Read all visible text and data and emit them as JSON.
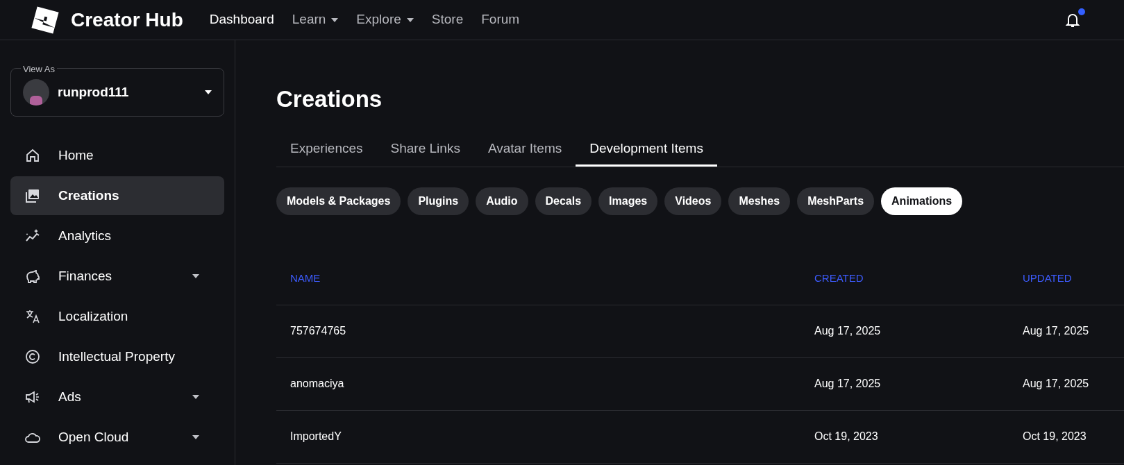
{
  "header": {
    "brand": "Creator Hub",
    "nav": [
      {
        "label": "Dashboard",
        "selected": true,
        "has_menu": false
      },
      {
        "label": "Learn",
        "selected": false,
        "has_menu": true
      },
      {
        "label": "Explore",
        "selected": false,
        "has_menu": true
      },
      {
        "label": "Store",
        "selected": false,
        "has_menu": false
      },
      {
        "label": "Forum",
        "selected": false,
        "has_menu": false
      }
    ],
    "notification_unread": true
  },
  "sidebar": {
    "view_as": {
      "label": "View As",
      "user": "runprod111"
    },
    "items": [
      {
        "label": "Home",
        "selected": false,
        "has_menu": false
      },
      {
        "label": "Creations",
        "selected": true,
        "has_menu": false
      },
      {
        "label": "Analytics",
        "selected": false,
        "has_menu": false
      },
      {
        "label": "Finances",
        "selected": false,
        "has_menu": true
      },
      {
        "label": "Localization",
        "selected": false,
        "has_menu": false
      },
      {
        "label": "Intellectual Property",
        "selected": false,
        "has_menu": false
      },
      {
        "label": "Ads",
        "selected": false,
        "has_menu": true
      },
      {
        "label": "Open Cloud",
        "selected": false,
        "has_menu": true
      }
    ]
  },
  "main": {
    "title": "Creations",
    "tabs": [
      {
        "label": "Experiences",
        "selected": false
      },
      {
        "label": "Share Links",
        "selected": false
      },
      {
        "label": "Avatar Items",
        "selected": false
      },
      {
        "label": "Development Items",
        "selected": true
      }
    ],
    "filters": [
      {
        "label": "Models & Packages",
        "selected": false
      },
      {
        "label": "Plugins",
        "selected": false
      },
      {
        "label": "Audio",
        "selected": false
      },
      {
        "label": "Decals",
        "selected": false
      },
      {
        "label": "Images",
        "selected": false
      },
      {
        "label": "Videos",
        "selected": false
      },
      {
        "label": "Meshes",
        "selected": false
      },
      {
        "label": "MeshParts",
        "selected": false
      },
      {
        "label": "Animations",
        "selected": true
      }
    ],
    "table": {
      "columns": [
        "NAME",
        "CREATED",
        "UPDATED"
      ],
      "rows": [
        [
          "757674765",
          "Aug 17, 2025",
          "Aug 17, 2025"
        ],
        [
          "anomaciya",
          "Aug 17, 2025",
          "Aug 17, 2025"
        ],
        [
          "ImportedY",
          "Oct 19, 2023",
          "Oct 19, 2023"
        ]
      ]
    }
  }
}
